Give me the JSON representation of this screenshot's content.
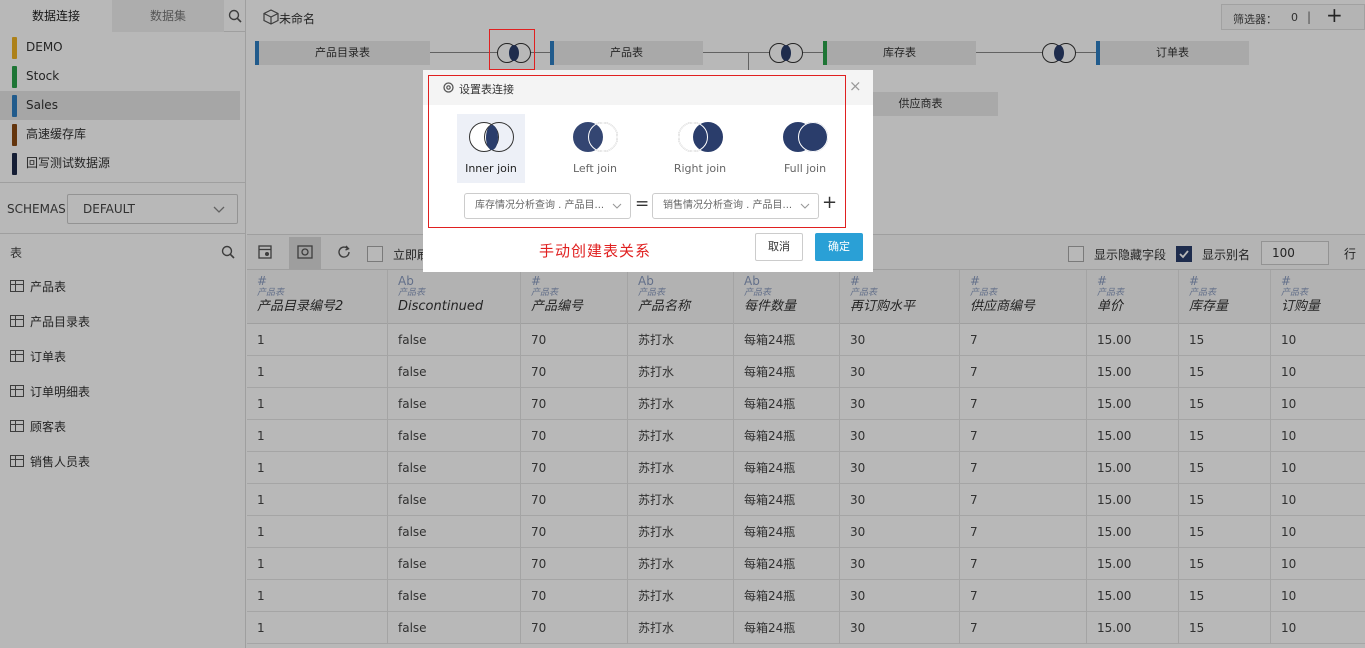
{
  "left_panel": {
    "tabs": [
      "数据连接",
      "数据集"
    ],
    "sources": [
      {
        "name": "DEMO",
        "color": "#f0b323"
      },
      {
        "name": "Stock",
        "color": "#2aa24a"
      },
      {
        "name": "Sales",
        "color": "#2f7ec2"
      },
      {
        "name": "高速缓存库",
        "color": "#8b4a13"
      },
      {
        "name": "回写测试数据源",
        "color": "#1e2a4a"
      }
    ],
    "schemas_label": "SCHEMAS",
    "schema_value": "DEFAULT",
    "tables_label": "表",
    "tables": [
      "产品表",
      "产品目录表",
      "订单表",
      "订单明细表",
      "顾客表",
      "销售人员表"
    ]
  },
  "header": {
    "title": "未命名",
    "filter_label": "筛选器：",
    "filter_count": "0",
    "filter_sep": "|",
    "add_label": "+"
  },
  "join_graph": {
    "tables": [
      "产品目录表",
      "产品表",
      "库存表",
      "订单表",
      "供应商表"
    ],
    "colors": {
      "blue": "#2f7ec2",
      "green": "#2aa24a"
    }
  },
  "toolbar": {
    "refresh_label": "立即刷",
    "show_hidden": "显示隐藏字段",
    "show_alias": "显示别名",
    "row_count": "100",
    "row_unit": "行"
  },
  "grid": {
    "columns": [
      {
        "type_icon": "#",
        "table": "产品表",
        "field": "产品目录编号2"
      },
      {
        "type_icon": "Ab",
        "table": "产品表",
        "field": "Discontinued"
      },
      {
        "type_icon": "#",
        "table": "产品表",
        "field": "产品编号"
      },
      {
        "type_icon": "Ab",
        "table": "产品表",
        "field": "产品名称"
      },
      {
        "type_icon": "Ab",
        "table": "产品表",
        "field": "每件数量"
      },
      {
        "type_icon": "#",
        "table": "产品表",
        "field": "再订购水平"
      },
      {
        "type_icon": "#",
        "table": "产品表",
        "field": "供应商编号"
      },
      {
        "type_icon": "#",
        "table": "产品表",
        "field": "单价"
      },
      {
        "type_icon": "#",
        "table": "产品表",
        "field": "库存量"
      },
      {
        "type_icon": "#",
        "table": "产品表",
        "field": "订购量"
      }
    ],
    "rows": [
      [
        "1",
        "false",
        "70",
        "苏打水",
        "每箱24瓶",
        "30",
        "7",
        "15.00",
        "15",
        "10"
      ],
      [
        "1",
        "false",
        "70",
        "苏打水",
        "每箱24瓶",
        "30",
        "7",
        "15.00",
        "15",
        "10"
      ],
      [
        "1",
        "false",
        "70",
        "苏打水",
        "每箱24瓶",
        "30",
        "7",
        "15.00",
        "15",
        "10"
      ],
      [
        "1",
        "false",
        "70",
        "苏打水",
        "每箱24瓶",
        "30",
        "7",
        "15.00",
        "15",
        "10"
      ],
      [
        "1",
        "false",
        "70",
        "苏打水",
        "每箱24瓶",
        "30",
        "7",
        "15.00",
        "15",
        "10"
      ],
      [
        "1",
        "false",
        "70",
        "苏打水",
        "每箱24瓶",
        "30",
        "7",
        "15.00",
        "15",
        "10"
      ],
      [
        "1",
        "false",
        "70",
        "苏打水",
        "每箱24瓶",
        "30",
        "7",
        "15.00",
        "15",
        "10"
      ],
      [
        "1",
        "false",
        "70",
        "苏打水",
        "每箱24瓶",
        "30",
        "7",
        "15.00",
        "15",
        "10"
      ],
      [
        "1",
        "false",
        "70",
        "苏打水",
        "每箱24瓶",
        "30",
        "7",
        "15.00",
        "15",
        "10"
      ],
      [
        "1",
        "false",
        "70",
        "苏打水",
        "每箱24瓶",
        "30",
        "7",
        "15.00",
        "15",
        "10"
      ]
    ]
  },
  "dialog": {
    "title": "设置表连接",
    "close": "×",
    "join_types": [
      "Inner join",
      "Left join",
      "Right join",
      "Full join"
    ],
    "left_field": "库存情况分析查询 . 产品目...",
    "equals": "=",
    "right_field": "销售情况分析查询 . 产品目...",
    "add": "+",
    "cancel": "取消",
    "confirm": "确定"
  },
  "annotation": {
    "text": "手动创建表关系",
    "color": "#e02020"
  }
}
